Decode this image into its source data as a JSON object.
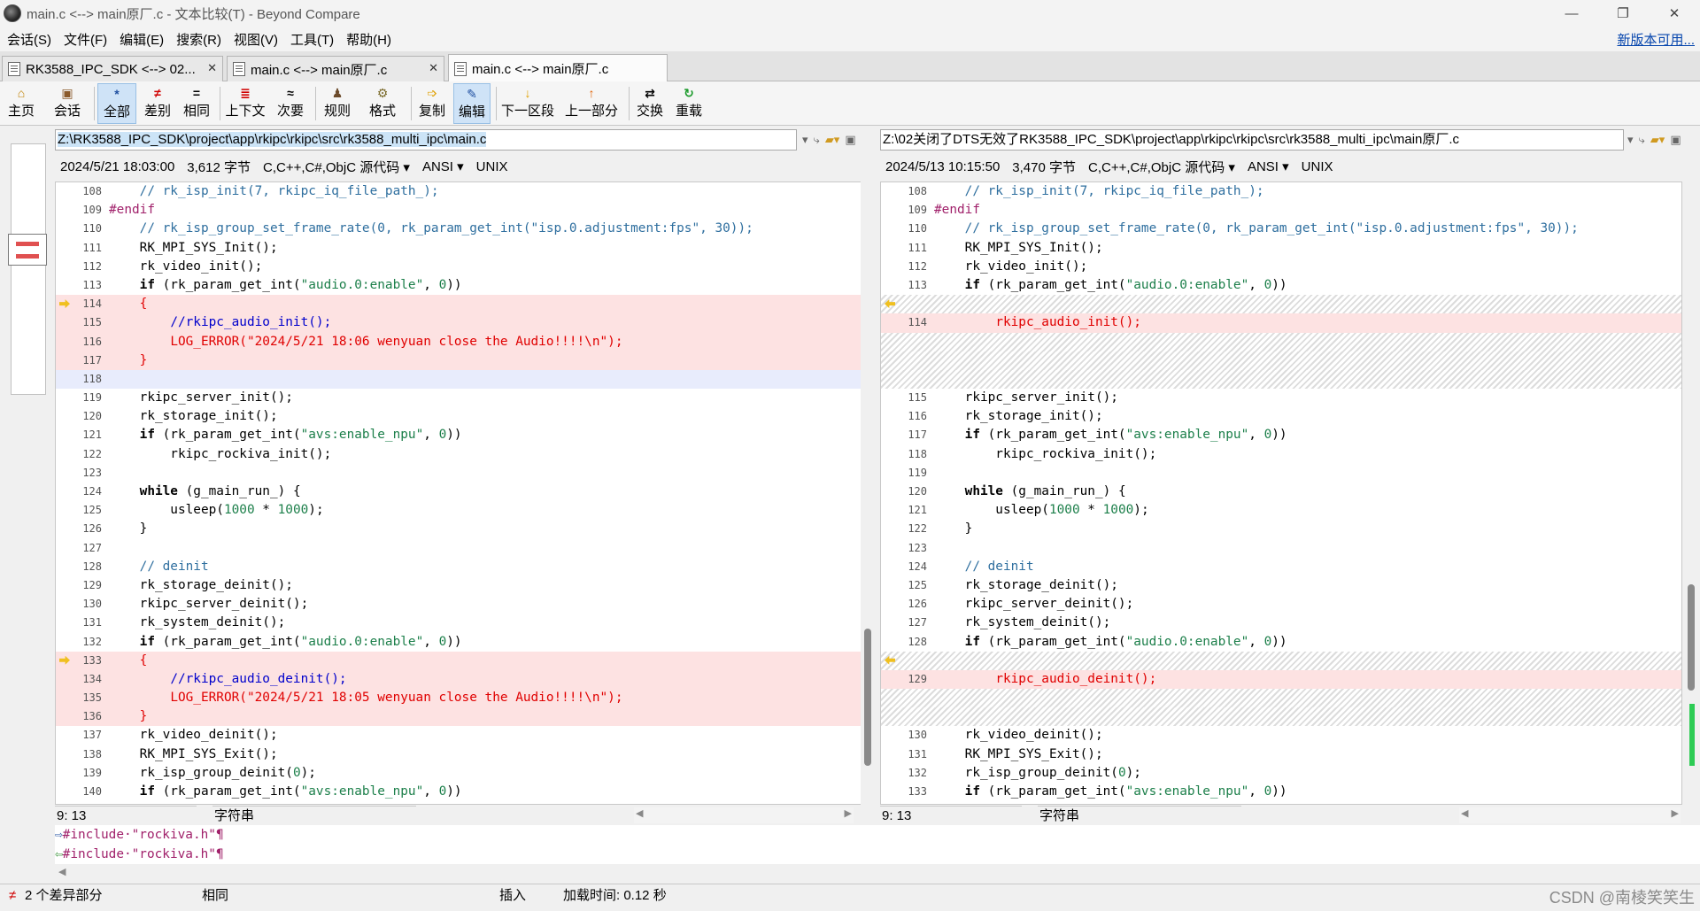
{
  "window": {
    "title": "main.c <--> main原厂.c - 文本比较(T) - Beyond Compare",
    "controls": [
      "—",
      "❐",
      "✕"
    ]
  },
  "menu": {
    "items": [
      "会话(S)",
      "文件(F)",
      "编辑(E)",
      "搜索(R)",
      "视图(V)",
      "工具(T)",
      "帮助(H)"
    ],
    "new_version": "新版本可用..."
  },
  "tabs": [
    {
      "label": "RK3588_IPC_SDK <--> 02...",
      "close": "✕"
    },
    {
      "label": "main.c <--> main原厂.c",
      "close": "✕"
    },
    {
      "label": "main.c <--> main原厂.c",
      "close": ""
    }
  ],
  "toolbar": {
    "home": {
      "icon": "⌂",
      "label": "主页"
    },
    "session": {
      "icon": "▣",
      "label": "会话"
    },
    "all": {
      "icon": "*",
      "label": "全部"
    },
    "diffs": {
      "icon": "≠",
      "label": "差别"
    },
    "same": {
      "icon": "=",
      "label": "相同"
    },
    "context": {
      "icon": "≣",
      "label": "上下文"
    },
    "minor": {
      "icon": "≈",
      "label": "次要"
    },
    "rules": {
      "icon": "♟",
      "label": "规则"
    },
    "format": {
      "icon": "⚙",
      "label": "格式"
    },
    "copy": {
      "icon": "➩",
      "label": "复制"
    },
    "edit": {
      "icon": "✎",
      "label": "编辑"
    },
    "next": {
      "icon": "↓",
      "label": "下一区段"
    },
    "prev": {
      "icon": "↑",
      "label": "上一部分"
    },
    "swap": {
      "icon": "⇄",
      "label": "交换"
    },
    "reload": {
      "icon": "↻",
      "label": "重载"
    }
  },
  "left": {
    "path": "Z:\\RK3588_IPC_SDK\\project\\app\\rkipc\\rkipc\\src\\rk3588_multi_ipc\\main.c",
    "date": "2024/5/21 18:03:00",
    "size": "3,612 字节",
    "lang": "C,C++,C#,ObjC 源代码",
    "enc": "ANSI",
    "eol": "UNIX",
    "pos": "9: 13",
    "kind": "字符串"
  },
  "right": {
    "path": "Z:\\02关闭了DTS无效了RK3588_IPC_SDK\\project\\app\\rkipc\\rkipc\\src\\rk3588_multi_ipc\\main原厂.c",
    "date": "2024/5/13 10:15:50",
    "size": "3,470 字节",
    "lang": "C,C++,C#,ObjC 源代码",
    "enc": "ANSI",
    "eol": "UNIX",
    "pos": "9: 13",
    "kind": "字符串"
  },
  "compare": {
    "line1": "#include·\"rockiva.h\"¶",
    "line2": "#include·\"rockiva.h\"¶"
  },
  "status": {
    "diff_count": "2 个差异部分",
    "same": "相同",
    "insert": "插入",
    "load_time": "加载时间: 0.12 秒"
  },
  "watermark": "CSDN @南棱笑笑生",
  "colors": {
    "diff_bg": "#fde2e2",
    "accent": "#cfe3f7",
    "changed_text": "#e00000"
  }
}
